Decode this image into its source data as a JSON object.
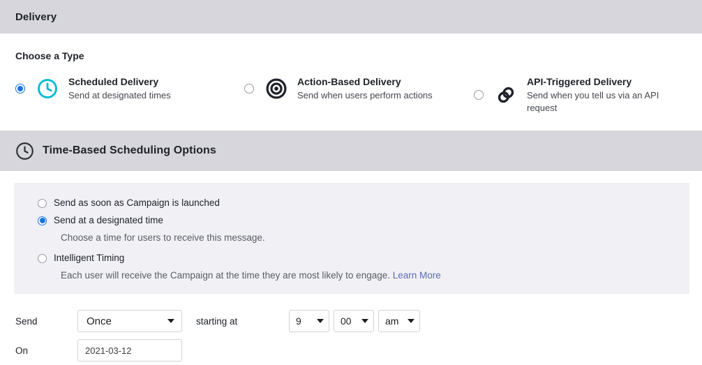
{
  "delivery_header": {
    "title": "Delivery"
  },
  "choose_type": {
    "label": "Choose a Type",
    "options": [
      {
        "title": "Scheduled Delivery",
        "subtitle": "Send at designated times",
        "icon": "clock-icon",
        "icon_color": "#00bcd4",
        "selected": true
      },
      {
        "title": "Action-Based Delivery",
        "subtitle": "Send when users perform actions",
        "icon": "target-icon",
        "icon_color": "#20232a",
        "selected": false
      },
      {
        "title": "API-Triggered Delivery",
        "subtitle": "Send when you tell us via an API request",
        "icon": "link-icon",
        "icon_color": "#20232a",
        "selected": false
      }
    ]
  },
  "scheduling_header": {
    "title": "Time-Based Scheduling Options",
    "icon": "clock-icon"
  },
  "scheduling_options": [
    {
      "label": "Send as soon as Campaign is launched",
      "description": "",
      "selected": false
    },
    {
      "label": "Send at a designated time",
      "description": "Choose a time for users to receive this message.",
      "selected": true
    },
    {
      "label": "Intelligent Timing",
      "description": "Each user will receive the Campaign at the time they are most likely to engage.",
      "link_label": "Learn More",
      "selected": false
    }
  ],
  "form": {
    "send_label": "Send",
    "frequency_value": "Once",
    "starting_at_label": "starting at",
    "hour_value": "9",
    "minute_value": "00",
    "meridiem_value": "am",
    "on_label": "On",
    "date_value": "2021-03-12",
    "date_placeholder": "YYYY-MM-DD"
  },
  "colors": {
    "header_bar": "#d6d6dc",
    "panel": "#f0f0f5",
    "accent_blue": "#1a73e8",
    "cyan": "#00bcd4",
    "link": "#5b6bb5"
  }
}
